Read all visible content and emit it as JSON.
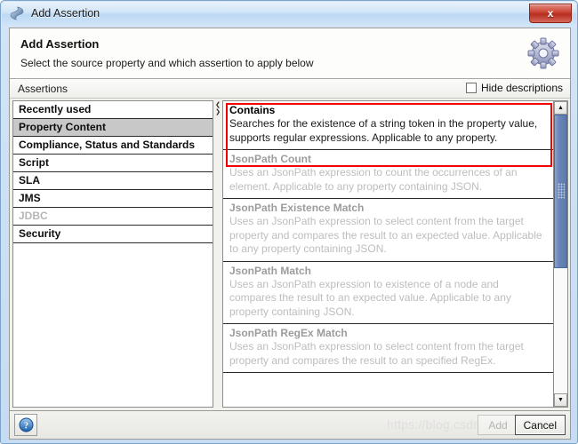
{
  "window": {
    "title": "Add Assertion",
    "icon": "soapui-diamond-icon",
    "close_label": "x"
  },
  "header": {
    "title": "Add Assertion",
    "subtitle": "Select the source property and which assertion to apply below",
    "gear_icon": "gear-icon"
  },
  "toolbar": {
    "assertions_label": "Assertions",
    "hide_descriptions_label": "Hide descriptions",
    "hide_descriptions_checked": false
  },
  "categories": [
    {
      "label": "Recently used",
      "selected": false,
      "disabled": false
    },
    {
      "label": "Property Content",
      "selected": true,
      "disabled": false
    },
    {
      "label": "Compliance, Status and Standards",
      "selected": false,
      "disabled": false
    },
    {
      "label": "Script",
      "selected": false,
      "disabled": false
    },
    {
      "label": "SLA",
      "selected": false,
      "disabled": false
    },
    {
      "label": "JMS",
      "selected": false,
      "disabled": false
    },
    {
      "label": "JDBC",
      "selected": false,
      "disabled": true
    },
    {
      "label": "Security",
      "selected": false,
      "disabled": false
    }
  ],
  "assertions": [
    {
      "title": "Contains",
      "description": "Searches for the existence of a string token in the property value, supports regular expressions. Applicable to any property.",
      "active": true
    },
    {
      "title": "JsonPath Count",
      "description": "Uses an JsonPath expression to count the occurrences of an element. Applicable to any property containing JSON.",
      "active": false
    },
    {
      "title": "JsonPath Existence Match",
      "description": "Uses an JsonPath expression to select content from the target property and compares the result to an expected value. Applicable to any property containing JSON.",
      "active": false
    },
    {
      "title": "JsonPath Match",
      "description": "Uses an JsonPath expression to existence of a node and compares the result to an expected value. Applicable to any property containing JSON.",
      "active": false
    },
    {
      "title": "JsonPath RegEx Match",
      "description": "Uses an JsonPath expression to select content from the target property and compares the result to an specified RegEx.",
      "active": false
    }
  ],
  "splitter": {
    "collapse_left": "❮",
    "collapse_right": "❯"
  },
  "scrollbar": {
    "up_arrow": "▲",
    "down_arrow": "▼",
    "thumb_percent": 55
  },
  "footer": {
    "help_label": "?",
    "add_label": "Add",
    "add_disabled": true,
    "cancel_label": "Cancel",
    "watermark": "https://blog.csdn.net/zhuyanfei"
  },
  "colors": {
    "highlight_red": "#f40000",
    "selection_gray": "#c8c8c8",
    "scrollbar_blue": "#5c79ae",
    "titlebar_blue": "#bcd9f3"
  }
}
